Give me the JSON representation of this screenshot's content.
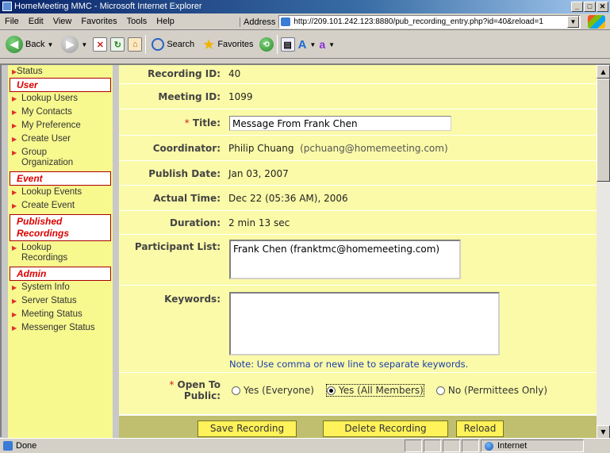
{
  "window": {
    "title": "HomeMeeting MMC - Microsoft Internet Explorer"
  },
  "menu": {
    "items": [
      "File",
      "Edit",
      "View",
      "Favorites",
      "Tools",
      "Help"
    ]
  },
  "address": {
    "label": "Address",
    "url": "http://209.101.242.123:8880/pub_recording_entry.php?id=40&reload=1"
  },
  "toolbar": {
    "back": "Back",
    "search": "Search",
    "favorites": "Favorites"
  },
  "sidebar": {
    "stub": "Status",
    "sections": [
      {
        "title": "User",
        "items": [
          "Lookup Users",
          "My Contacts",
          "My Preference",
          "Create User",
          "Group Organization"
        ]
      },
      {
        "title": "Event",
        "items": [
          "Lookup Events",
          "Create Event"
        ]
      },
      {
        "title": "Published Recordings",
        "items": [
          "Lookup Recordings"
        ]
      },
      {
        "title": "Admin",
        "items": [
          "System Info",
          "Server Status",
          "Meeting Status",
          "Messenger Status"
        ]
      }
    ]
  },
  "form": {
    "recording_id": {
      "label": "Recording ID:",
      "value": "40"
    },
    "meeting_id": {
      "label": "Meeting ID:",
      "value": "1099"
    },
    "title": {
      "required": "*",
      "label": "Title:",
      "value": "Message From Frank Chen"
    },
    "coordinator": {
      "label": "Coordinator:",
      "name": "Philip Chuang",
      "email": "(pchuang@homemeeting.com)"
    },
    "publish_date": {
      "label": "Publish Date:",
      "value": "Jan 03, 2007"
    },
    "actual_time": {
      "label": "Actual Time:",
      "value": "Dec 22 (05:36 AM), 2006"
    },
    "duration": {
      "label": "Duration:",
      "value": "2 min 13 sec"
    },
    "participants": {
      "label": "Participant List:",
      "items": [
        "Frank Chen (franktmc@homemeeting.com)"
      ]
    },
    "keywords": {
      "label": "Keywords:",
      "value": "",
      "note": "Note: Use comma or new line to separate keywords."
    },
    "open_to_public": {
      "required": "*",
      "label_line1": "Open To",
      "label_line2": "Public:",
      "options": [
        "Yes (Everyone)",
        "Yes (All Members)",
        "No (Permittees Only)"
      ],
      "selected": "Yes (All Members)"
    }
  },
  "buttons": {
    "save": "Save Recording",
    "delete": "Delete Recording",
    "reload": "Reload"
  },
  "status": {
    "text": "Done",
    "zone": "Internet"
  }
}
